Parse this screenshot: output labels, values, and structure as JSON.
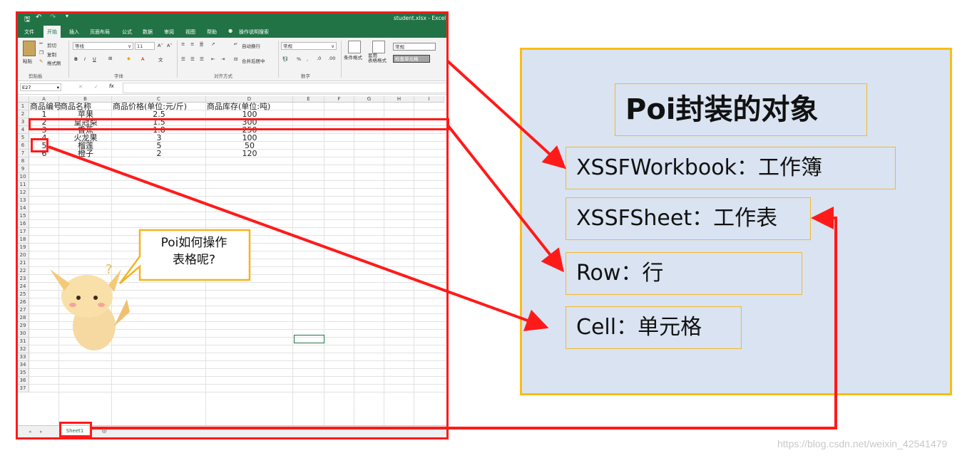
{
  "excel": {
    "filename": "student.xlsx  -  Excel",
    "qat_icons": [
      "save-icon",
      "undo-icon",
      "redo-icon",
      "customize-icon"
    ],
    "menu": [
      "文件",
      "开始",
      "插入",
      "页面布局",
      "公式",
      "数据",
      "审阅",
      "视图",
      "帮助",
      "操作说明搜索"
    ],
    "active_menu_index": 1,
    "ribbon": {
      "paste": "粘贴",
      "cut": "剪切",
      "copy": "复制",
      "format_painter": "格式刷",
      "font_name": "等线",
      "font_size": "11",
      "wrap_text": "自动换行",
      "merge_center": "合并后居中",
      "number_format": "常规",
      "conditional_format": "条件格式",
      "table_format": "套用\n表格格式",
      "style_normal": "常规",
      "style_check": "检查单元格",
      "groups": [
        "剪贴板",
        "字体",
        "对齐方式",
        "数字"
      ]
    },
    "name_box": "E27",
    "formula_icons": [
      "cancel-icon",
      "enter-icon",
      "fx-icon"
    ],
    "columns": [
      "A",
      "B",
      "C",
      "D",
      "E",
      "F",
      "G",
      "H",
      "I"
    ],
    "rows": [
      "1",
      "2",
      "3",
      "4",
      "5",
      "6",
      "7",
      "8",
      "9",
      "10",
      "11",
      "12",
      "13",
      "14",
      "15",
      "16",
      "17",
      "18",
      "19",
      "20",
      "21",
      "22",
      "23",
      "24",
      "25",
      "26",
      "27",
      "28",
      "29",
      "30",
      "31",
      "32",
      "33",
      "34",
      "35",
      "36",
      "37"
    ],
    "headers": [
      "商品编号",
      "商品名称",
      "商品价格(单位:元/斤)",
      "商品库存(单位:吨)"
    ],
    "data": [
      [
        "1",
        "苹果",
        "2.5",
        "100"
      ],
      [
        "2",
        "皇冠梨",
        "1.5",
        "300"
      ],
      [
        "3",
        "香蕉",
        "1.8",
        "250"
      ],
      [
        "4",
        "火龙果",
        "3",
        "100"
      ],
      [
        "5",
        "榴莲",
        "5",
        "50"
      ],
      [
        "6",
        "橙子",
        "2",
        "120"
      ]
    ],
    "sheet_tab": "Sheet1",
    "speech_bubble": "Poi如何操作\n表格呢?"
  },
  "panel": {
    "title": "Poi封装的对象",
    "items": [
      "XSSFWorkbook：工作簿",
      "XSSFSheet：工作表",
      "Row：行",
      "Cell：单元格"
    ]
  },
  "colors": {
    "excel_green": "#217346",
    "highlight_red": "#ff1a1a",
    "panel_bg": "#dae3f1",
    "panel_border": "#fbbd13"
  },
  "watermark": "https://blog.csdn.net/weixin_42541479"
}
